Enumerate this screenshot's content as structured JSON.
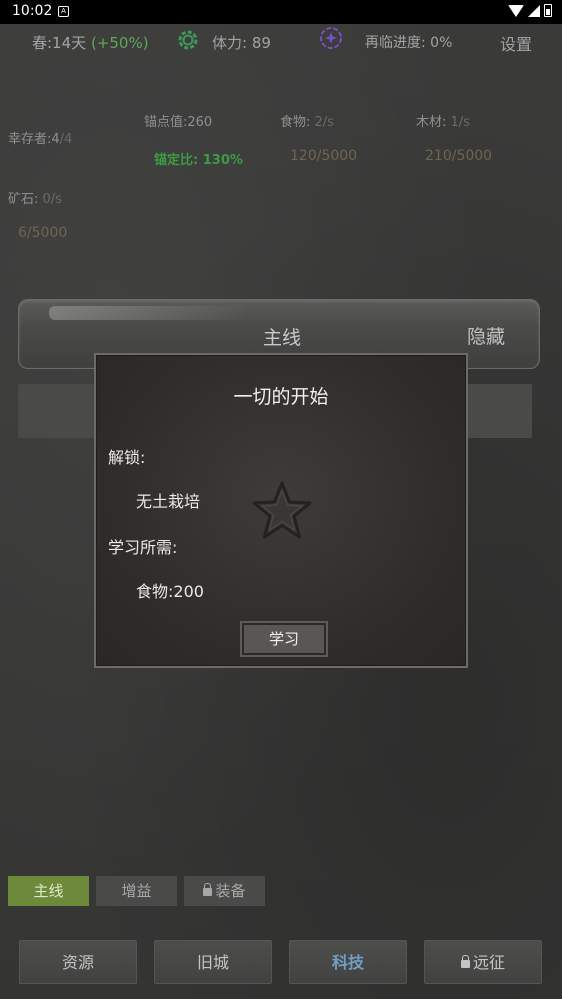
{
  "status_bar": {
    "time": "10:02"
  },
  "top_bar": {
    "season": "春:14天",
    "season_bonus": "(+50%)",
    "stamina": "体力:  89",
    "progress": "再临进度:  0%",
    "settings": "设置",
    "gear_icon_color": "#3d9a5a",
    "portal_icon_color": "#7a4fc0"
  },
  "resources": {
    "survivors_label": "幸存者:4",
    "survivors_max": "/4",
    "anchor_value": "锚点值:260",
    "anchor_ratio": "锚定比:  130%",
    "food_label": "食物:",
    "food_rate": "2/s",
    "food_cap": "120/5000",
    "wood_label": "木材:",
    "wood_rate": "1/s",
    "wood_cap": "210/5000",
    "ore_label": "矿石:",
    "ore_rate": "0/s",
    "ore_cap": "6/5000"
  },
  "main_bar": {
    "title": "主线",
    "hide": "隐藏"
  },
  "dialog": {
    "title": "一切的开始",
    "unlock_label": "解锁:",
    "unlock_value": "无土栽培",
    "require_label": "学习所需:",
    "require_value": "食物:200",
    "learn_button": "学习"
  },
  "tabs": [
    {
      "label": "主线",
      "active": true
    },
    {
      "label": "增益",
      "active": false
    },
    {
      "label": "装备",
      "active": false,
      "locked": true
    }
  ],
  "bottom_nav": [
    {
      "label": "资源",
      "active": false
    },
    {
      "label": "旧城",
      "active": false
    },
    {
      "label": "科技",
      "active": true
    },
    {
      "label": "远征",
      "active": false,
      "locked": true
    }
  ]
}
